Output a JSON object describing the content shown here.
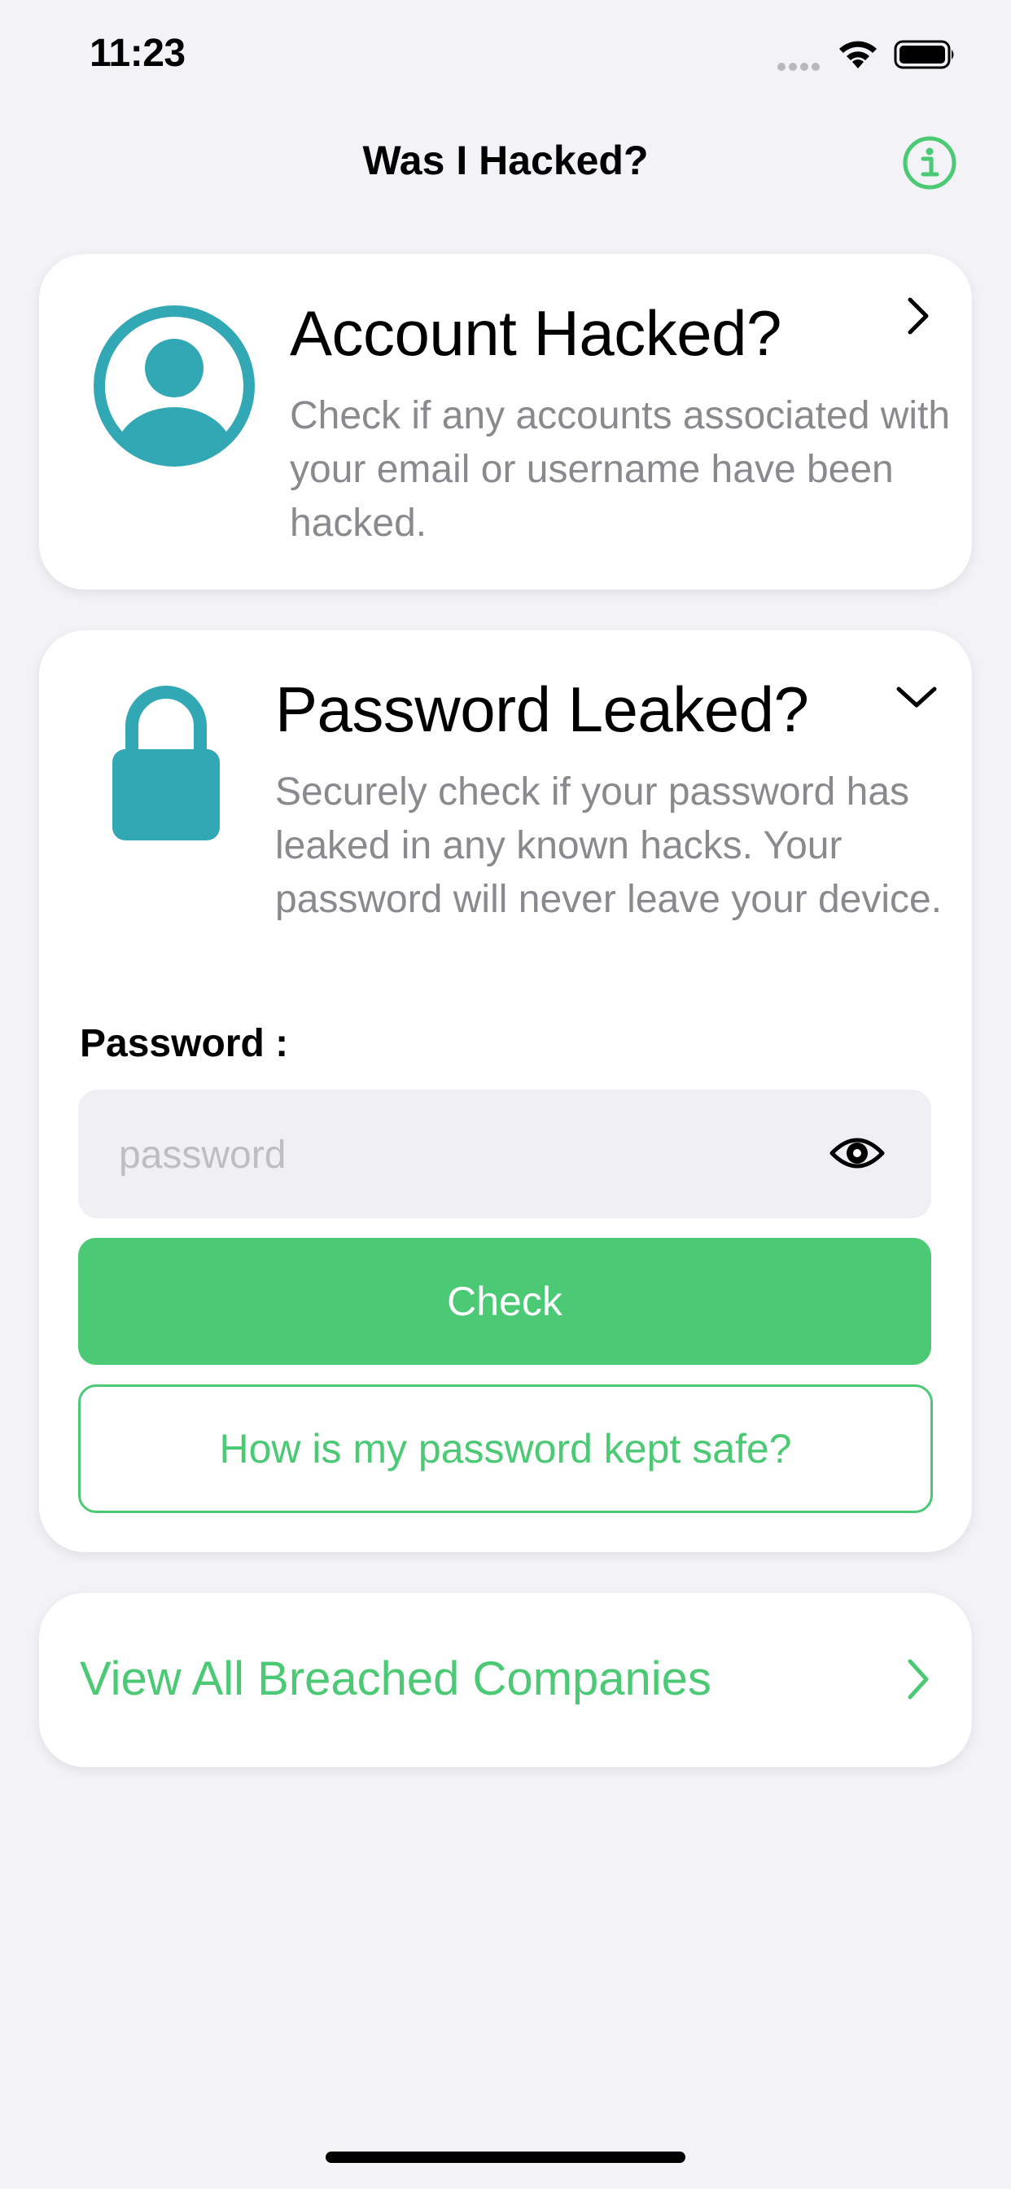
{
  "status_bar": {
    "time": "11:23",
    "icons": [
      "signal-icon",
      "wifi-icon",
      "battery-icon"
    ]
  },
  "nav": {
    "title": "Was I Hacked?",
    "info_icon": "info-icon"
  },
  "account_card": {
    "icon": "user-avatar-icon",
    "title": "Account Hacked?",
    "description": "Check if any accounts associated with your email or username have been hacked.",
    "chevron": "chevron-right-icon"
  },
  "password_card": {
    "icon": "lock-icon",
    "title": "Password Leaked?",
    "description": "Securely check if your password has leaked in any known hacks. Your password will never leave your device.",
    "chevron": "chevron-down-icon",
    "field_label": "Password :",
    "field_placeholder": "password",
    "field_value": "",
    "check_label": "Check",
    "safe_label": "How is my password kept safe?"
  },
  "breached_card": {
    "label": "View All Breached Companies",
    "chevron": "chevron-right-icon"
  },
  "colors": {
    "accent_green": "#4bc974",
    "icon_teal": "#33a8b5",
    "background": "#f2f2f7",
    "secondary_text": "#8a8a8e"
  }
}
